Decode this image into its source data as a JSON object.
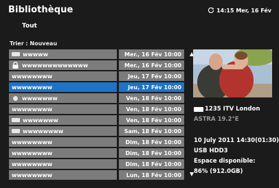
{
  "header": {
    "title": "Bibliothèque",
    "filter": "Tout",
    "clock": "14:15 Mer, 16 Fév"
  },
  "sort_label": "Trier : Nouveau",
  "recordings": [
    {
      "name": "wwwww",
      "date": "Mer., 16 Fév 10:00",
      "icon": "rect-icon",
      "selected": false
    },
    {
      "name": "wwwwwwwwwwwww",
      "date": "Mer., 16 Fév 10:00",
      "icon": "lock-icon",
      "selected": false
    },
    {
      "name": "wwwwwwww",
      "date": "Jeu, 17 Fév 10:00",
      "icon": "",
      "selected": false
    },
    {
      "name": "wwwwwwww",
      "date": "Jeu, 17 Fév 10:00",
      "icon": "",
      "selected": true
    },
    {
      "name": "wwwwwww",
      "date": "Ven, 18 Fév 10:00",
      "icon": "circle-icon",
      "selected": false
    },
    {
      "name": "wwwwwwww",
      "date": "Ven, 18 Fév 10:00",
      "icon": "",
      "selected": false
    },
    {
      "name": "wwwwwww",
      "date": "Ven, 18 Fév 10:00",
      "icon": "rect-icon",
      "selected": false
    },
    {
      "name": "wwwwwwww",
      "date": "Sam, 18 Fév 10:00",
      "icon": "rect-icon",
      "selected": false
    },
    {
      "name": "wwwwwwww",
      "date": "Dim, 18 Fév 10:00",
      "icon": "",
      "selected": false
    },
    {
      "name": "wwwwwwww",
      "date": "Dim, 18 Fév 10:00",
      "icon": "",
      "selected": false
    },
    {
      "name": "wwwwwwww",
      "date": "Dim, 18 Fév 10:00",
      "icon": "",
      "selected": false
    },
    {
      "name": "wwwwwwww",
      "date": "Lun, 18 Fév 10:00",
      "icon": "",
      "selected": false
    }
  ],
  "info": {
    "channel": "1235 ITV London",
    "satellite": "ASTRA 19.2°E",
    "datetime": "10 July 2011  14:30(01:30)",
    "storage": "USB HDD3",
    "space_label": "Espace disponible:",
    "space_value": "86% (912.0GB)"
  },
  "colors": {
    "background": "#1b1b1b",
    "row": "#7c7c7c",
    "selected_row": "#1e73c6",
    "dim_text": "#9a9a9a"
  }
}
